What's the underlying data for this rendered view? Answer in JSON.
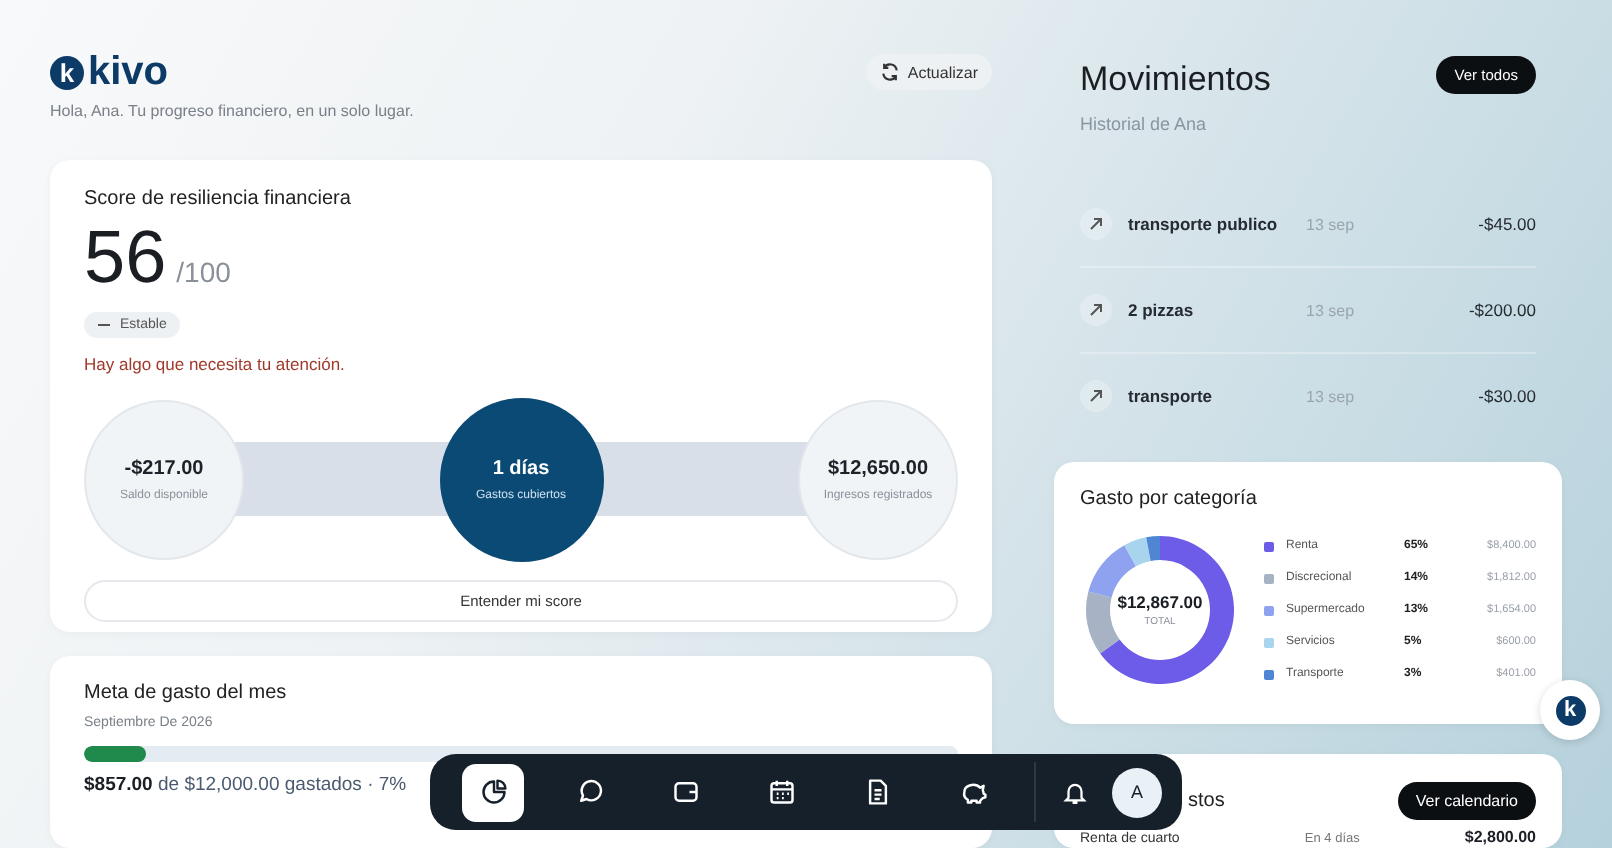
{
  "brand": {
    "mark": "k",
    "name": "kivo"
  },
  "assistant_button": {
    "mark": "k"
  },
  "greeting": "Hola, Ana. Tu progreso financiero, en un solo lugar.",
  "refresh_button": "Actualizar",
  "score_card": {
    "title": "Score de resiliencia financiera",
    "score": "56",
    "max": "/100",
    "trend": "Estable",
    "alert": "Hay algo que necesita tu atención.",
    "stats": [
      {
        "value": "-$217.00",
        "label": "Saldo disponible",
        "highlighted": false
      },
      {
        "value": "1 días",
        "label": "Gastos cubiertos",
        "highlighted": true
      },
      {
        "value": "$12,650.00",
        "label": "Ingresos registrados",
        "highlighted": false
      }
    ],
    "button": "Entender mi score"
  },
  "budget_card": {
    "title": "Meta de gasto del mes",
    "subtitle": "Septiembre De 2026",
    "level": 0.07,
    "spent": "$857.00",
    "detail": "de $12,000.00 gastados · 7%"
  },
  "movements": {
    "title": "Movimientos",
    "subtitle": "Historial de Ana",
    "button": "Ver todos",
    "rows": [
      {
        "name": "transporte publico",
        "date": "13 sep",
        "amount": "-$45.00"
      },
      {
        "name": "2 pizzas",
        "date": "13 sep",
        "amount": "-$200.00"
      },
      {
        "name": "transporte",
        "date": "13 sep",
        "amount": "-$30.00"
      }
    ]
  },
  "category_card": {
    "title": "Gasto por categoría",
    "total": "$12,867.00",
    "total_label": "TOTAL",
    "items": [
      {
        "percent": "65%",
        "amount": "$8,400.00",
        "color": "#6c5ce7"
      },
      {
        "percent": "14%",
        "amount": "$1,812.00",
        "color": "#a7b2c4"
      },
      {
        "percent": "13%",
        "amount": "$1,654.00",
        "color": "#8ea2ef"
      },
      {
        "percent": "5%",
        "amount": "$600.00",
        "color": "#a8d4ee"
      },
      {
        "percent": "3%",
        "amount": "$401.00",
        "color": "#4f86d4"
      }
    ],
    "chart_data": {
      "type": "donut",
      "categories": [
        "Renta",
        "Discrecional",
        "Supermercado",
        "Servicios",
        "Transporte"
      ],
      "values": [
        65,
        14,
        13,
        5,
        3
      ]
    }
  },
  "upcoming_card": {
    "title": "stos",
    "button": "Ver calendario",
    "rows": [
      {
        "name": "Renta de cuarto",
        "when": "En 4 días",
        "amount": "$2,800.00"
      }
    ]
  },
  "nav": {
    "items": [
      {
        "kind": "chart",
        "selected": true
      },
      {
        "kind": "chat",
        "selected": false
      },
      {
        "kind": "wallet",
        "selected": false
      },
      {
        "kind": "calendar",
        "selected": false
      },
      {
        "kind": "document",
        "selected": false
      },
      {
        "kind": "piggy",
        "selected": false
      }
    ],
    "avatar": "A"
  }
}
